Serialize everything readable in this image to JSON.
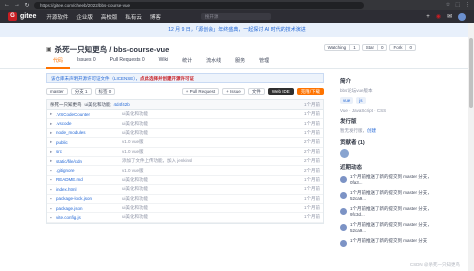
{
  "browser": {
    "url": "https://gitee.com/cheeb/2022/bbs-course-vue"
  },
  "header": {
    "logo_text": "gitee",
    "nav": [
      "开源软件",
      "企业版",
      "高校版",
      "私有云",
      "博客"
    ],
    "search_placeholder": "搜开源"
  },
  "banner": {
    "text": "12 月 9 日，「源创会」年终盛典，一起探讨 AI 时代的技术演进"
  },
  "repo": {
    "owner_and_name": "杀死一只知更鸟 / bbs-course-vue",
    "watch_label": "Watching",
    "watch_count": "1",
    "star_label": "Star",
    "star_count": "0",
    "fork_label": "Fork",
    "fork_count": "0"
  },
  "tabs": [
    {
      "label": "代码",
      "active": true
    },
    {
      "label": "Issues 0"
    },
    {
      "label": "Pull Requests 0"
    },
    {
      "label": "Wiki"
    },
    {
      "label": "统计"
    },
    {
      "label": "流水线"
    },
    {
      "label": "服务"
    },
    {
      "label": "管理"
    }
  ],
  "notice": {
    "text": "该仓库未声明开源许可证文件（LICENSE），",
    "action": "点此选择并创建开源许可证"
  },
  "toolbar": {
    "branch": "master",
    "branches": "分支 1",
    "tags": "标签 0",
    "pull_request": "+ Pull Request",
    "issue": "+ Issue",
    "file": "文件",
    "webide": "Web IDE",
    "clone": "克隆/下载"
  },
  "commit": {
    "who": "杀死一只知更鸟",
    "msg": "ui美化和功能",
    "hash": "4d4f42b",
    "time": "1个月前"
  },
  "files": [
    {
      "name": ".VSCodeCounter",
      "msg": "ui美化和功能",
      "time": "1个月前"
    },
    {
      "name": ".vscode",
      "msg": "ui美化和功能",
      "time": "1个月前"
    },
    {
      "name": "node_modules",
      "msg": "ui美化和功能",
      "time": "1个月前"
    },
    {
      "name": "public",
      "msg": "v1.0 vue版",
      "time": "2个月前"
    },
    {
      "name": "src",
      "msg": "v1.0 vue版",
      "time": "2个月前"
    },
    {
      "name": "static/file/cdn",
      "msg": "添加了文件上传功能，加入 jenkinsl",
      "time": "2个月前"
    },
    {
      "name": ".gitignore",
      "msg": "v1.0 vue版",
      "time": "2个月前"
    },
    {
      "name": "README.md",
      "msg": "ui美化和功能",
      "time": "1个月前"
    },
    {
      "name": "index.html",
      "msg": "ui美化和功能",
      "time": "1个月前"
    },
    {
      "name": "package-lock.json",
      "msg": "ui美化和功能",
      "time": "1个月前"
    },
    {
      "name": "package.json",
      "msg": "ui美化和功能",
      "time": "1个月前"
    },
    {
      "name": "vite.config.js",
      "msg": "ui美化和功能",
      "time": "1个月前"
    }
  ],
  "sidebar": {
    "intro_title": "简介",
    "intro_text": "bbs论坛vue版本",
    "lang_tags": [
      "vue",
      "js"
    ],
    "langs": [
      "Vue",
      "JavaScript",
      "CSS"
    ],
    "release_title": "发行版",
    "release_text": "暂无发行版，",
    "release_link": "创建",
    "contrib_title": "贡献者",
    "contrib_count": "(1)",
    "activity_title": "近期动态",
    "activities": [
      "1个月前推送了新的提交到 master 分支，0fa3...",
      "1个月前推送了新的提交到 master 分支，52ca9...",
      "1个月前推送了新的提交到 master 分支，9fc3d...",
      "1个月前推送了新的提交到 master 分支，52ca9...",
      "1个月前推送了新的提交到 master 分支"
    ]
  },
  "watermark": "CSDN @杀死一只知更鸟"
}
